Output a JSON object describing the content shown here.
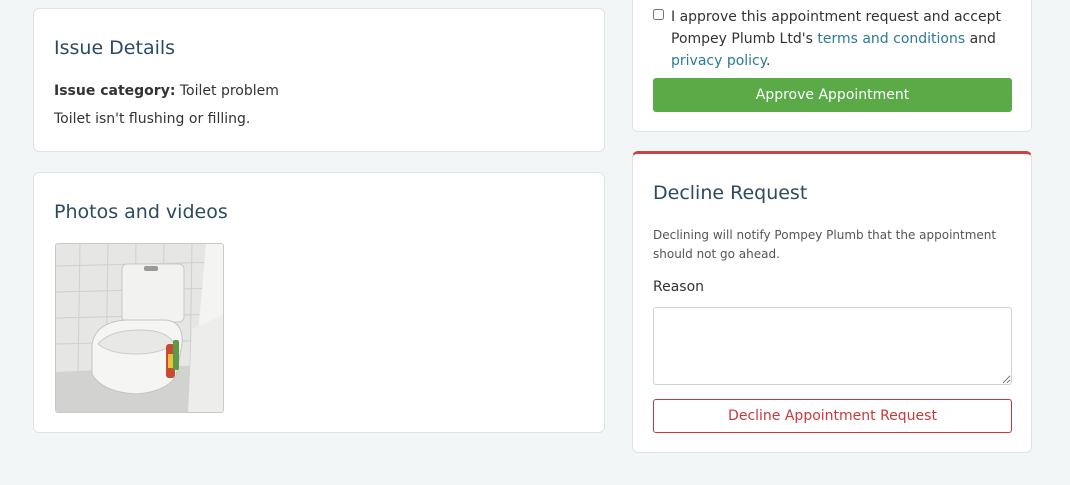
{
  "issue": {
    "title": "Issue Details",
    "category_label": "Issue category:",
    "category_value": "Toilet problem",
    "description": "Toilet isn't flushing or filling."
  },
  "photos": {
    "title": "Photos and videos",
    "items": [
      {
        "alt": "Toilet photo"
      }
    ]
  },
  "approve": {
    "text_before": "I approve this appointment request and accept Pompey Plumb Ltd's ",
    "terms_link": "terms and conditions",
    "text_mid": " and ",
    "privacy_link": "privacy policy",
    "text_after": ".",
    "button_label": "Approve Appointment",
    "button_color": "#5aaa48"
  },
  "decline": {
    "title": "Decline Request",
    "note": "Declining will notify Pompey Plumb that the appointment should not go ahead.",
    "reason_label": "Reason",
    "reason_value": "",
    "button_label": "Decline Appointment Request",
    "accent_color": "#d0443f"
  }
}
